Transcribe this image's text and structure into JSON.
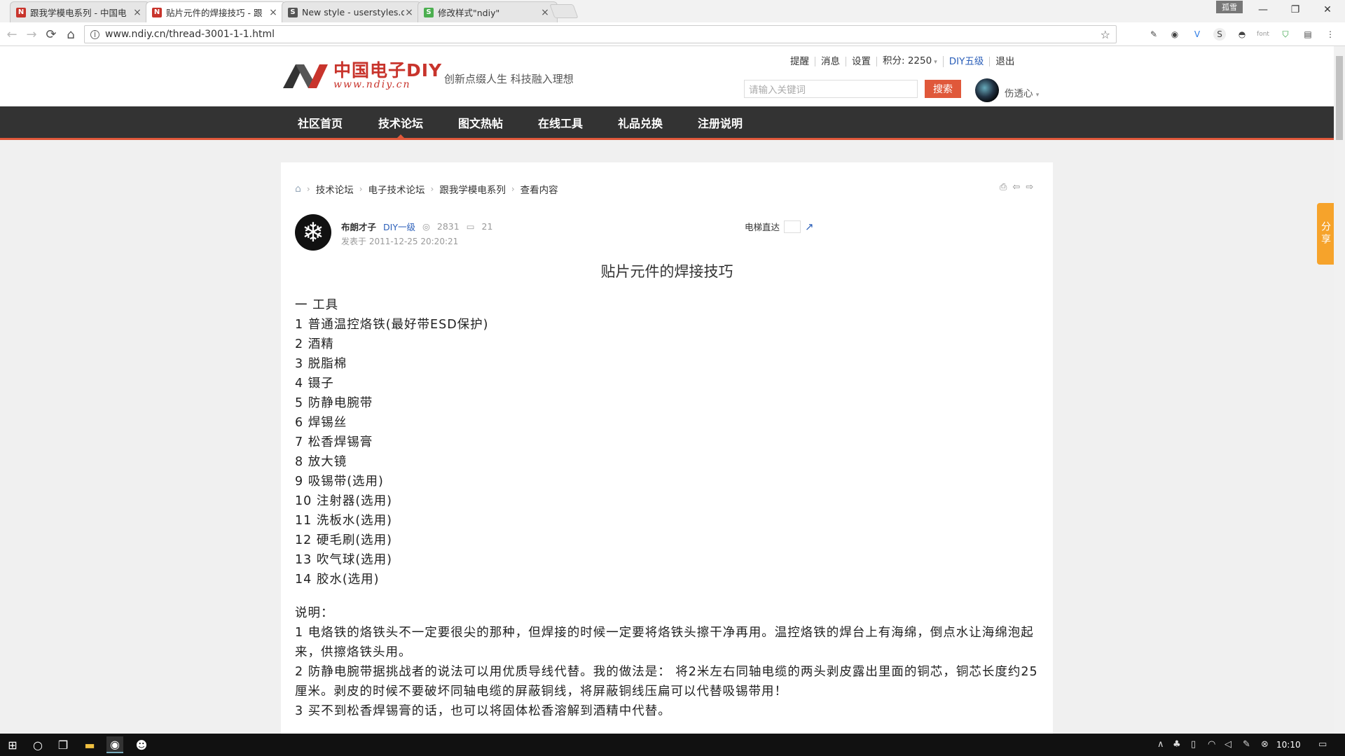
{
  "browser": {
    "tabs": [
      {
        "label": "跟我学模电系列 - 中国电",
        "favicon": "N",
        "color": "#c8342c"
      },
      {
        "label": "贴片元件的焊接技巧 - 跟",
        "favicon": "N",
        "color": "#c8342c",
        "active": true
      },
      {
        "label": "New style - userstyles.o",
        "favicon": "S",
        "color": "#555555"
      },
      {
        "label": "修改样式\"ndiy\"",
        "favicon": "S",
        "color": "#4caf50"
      }
    ],
    "close_glyph": "×",
    "user_badge": "孤雪",
    "window_controls": {
      "minimize": "—",
      "restore": "❐",
      "close": "✕"
    },
    "url": "www.ndiy.cn/thread-3001-1-1.html",
    "extension_icons": [
      "evernote-icon",
      "ghostery-icon",
      "vimium-icon",
      "stylish-icon",
      "mask-icon",
      "font-icon",
      "shield-icon",
      "menu-icon"
    ],
    "ext_font_label": "font"
  },
  "site": {
    "logo_cn": "中国电子DIY",
    "logo_url": "www.ndiy.cn",
    "slogan": "创新点缀人生 科技融入理想",
    "userlinks": {
      "remind": "提醒",
      "messages": "消息",
      "settings": "设置",
      "points": "积分: 2250",
      "level": "DIY五级",
      "logout": "退出"
    },
    "search_placeholder": "请输入关键词",
    "search_button": "搜索",
    "username": "伤透心",
    "nav": [
      "社区首页",
      "技术论坛",
      "图文热帖",
      "在线工具",
      "礼品兑换",
      "注册说明"
    ],
    "brand_color": "#e0583a"
  },
  "breadcrumb": [
    "技术论坛",
    "电子技术论坛",
    "跟我学模电系列",
    "查看内容"
  ],
  "post": {
    "author": "布朗才子",
    "level": "DIY一级",
    "views": "2831",
    "replies": "21",
    "date": "发表于 2011-12-25 20:20:21",
    "elevator_label": "电梯直达",
    "title": "贴片元件的焊接技巧",
    "section1_heading": "一 工具",
    "tools": [
      "1 普通温控烙铁(最好带ESD保护)",
      "2 酒精",
      "3 脱脂棉",
      "4 镊子",
      "5 防静电腕带",
      "6 焊锡丝",
      "7 松香焊锡膏",
      "8 放大镜",
      "9 吸锡带(选用)",
      "10 注射器(选用)",
      "11 洗板水(选用)",
      "12 硬毛刷(选用)",
      "13 吹气球(选用)",
      "14 胶水(选用)"
    ],
    "notes_heading": "说明：",
    "notes": [
      "1 电烙铁的烙铁头不一定要很尖的那种，但焊接的时候一定要将烙铁头擦干净再用。温控烙铁的焊台上有海绵，倒点水让海绵泡起来，供擦烙铁头用。",
      "2 防静电腕带据挑战者的说法可以用优质导线代替。我的做法是： 将2米左右同轴电缆的两头剥皮露出里面的铜芯，铜芯长度约25厘米。剥皮的时候不要破坏同轴电缆的屏蔽铜线，将屏蔽铜线压扁可以代替吸锡带用！",
      "3 买不到松香焊锡膏的话，也可以将固体松香溶解到酒精中代替。"
    ]
  },
  "share_label": "分享",
  "taskbar": {
    "time": "10:10"
  }
}
